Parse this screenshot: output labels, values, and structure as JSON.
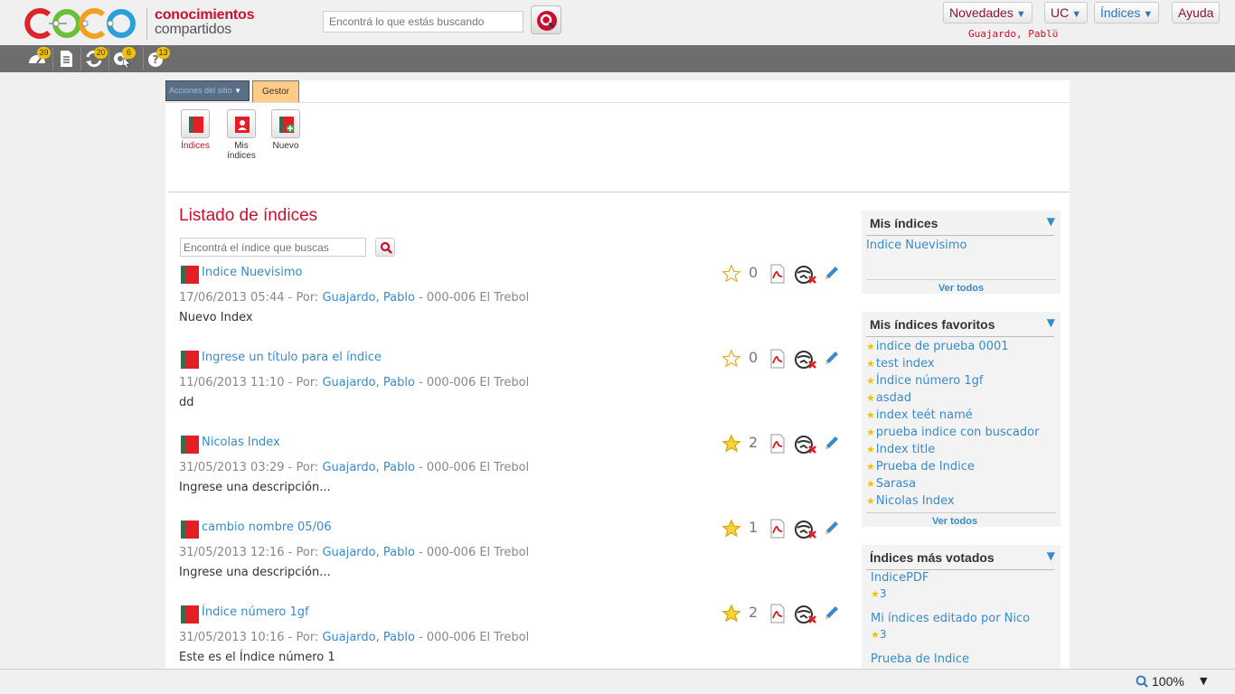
{
  "header": {
    "logo_text_1": "conocimientos",
    "logo_text_2": "compartidos",
    "search_placeholder": "Encontrá lo que estás buscando",
    "nav": [
      {
        "label": "Novedades"
      },
      {
        "label": "UC"
      },
      {
        "label": "Índices"
      },
      {
        "label": "Ayuda"
      }
    ],
    "user_name": "Guajardo, Pablo"
  },
  "toolbar": {
    "badges": [
      "39",
      "",
      "20",
      "6",
      "13"
    ]
  },
  "ribbon": {
    "site_actions": "Acciones del sitio",
    "tab": "Gestor",
    "buttons": [
      {
        "label": "Índices"
      },
      {
        "label": "Mis índices"
      },
      {
        "label": "Nuevo"
      }
    ]
  },
  "main": {
    "title": "Listado de índices",
    "search_placeholder": "Encontrá el índice que buscas",
    "entries": [
      {
        "title": "Indice Nuevisimo",
        "date": "17/06/2013 05:44",
        "por": " - Por: ",
        "author": "Guajardo, Pablo",
        "group": " - 000-006 El Trebol",
        "desc": "Nuevo Index",
        "votes": "0",
        "starred": false
      },
      {
        "title": "Ingrese un título para el índice",
        "date": "11/06/2013 11:10",
        "por": " - Por: ",
        "author": "Guajardo, Pablo",
        "group": " - 000-006 El Trebol",
        "desc": "dd",
        "votes": "0",
        "starred": false
      },
      {
        "title": "Nicolas Index",
        "date": "31/05/2013 03:29",
        "por": " - Por: ",
        "author": "Guajardo, Pablo",
        "group": " - 000-006 El Trebol",
        "desc": "Ingrese una descripción...",
        "votes": "2",
        "starred": true
      },
      {
        "title": "cambio nombre 05/06",
        "date": "31/05/2013 12:16",
        "por": " - Por: ",
        "author": "Guajardo, Pablo",
        "group": " - 000-006 El Trebol",
        "desc": "Ingrese una descripción...",
        "votes": "1",
        "starred": true
      },
      {
        "title": "Índice número 1gf",
        "date": "31/05/2013 10:16",
        "por": " - Por: ",
        "author": "Guajardo, Pablo",
        "group": " - 000-006 El Trebol",
        "desc": "Este es el Índice número 1",
        "votes": "2",
        "starred": true
      }
    ]
  },
  "sidebar": {
    "mis_indices": {
      "title": "Mis índices",
      "items": [
        "Indice Nuevisimo"
      ],
      "footer": "Ver todos"
    },
    "favoritos": {
      "title": "Mis índices favoritos",
      "items": [
        "indice de prueba 0001",
        "test index",
        "Índice número 1gf",
        "asdad",
        "index teét namé",
        "prueba indice con buscador",
        "Index title",
        "Prueba de Indice",
        "Sarasa",
        "Nicolas Index"
      ],
      "footer": "Ver todos"
    },
    "mas_votados": {
      "title": "Índices más votados",
      "items": [
        {
          "name": "IndicePDF",
          "votes": "3"
        },
        {
          "name": "Mi índices editado por Nico",
          "votes": "3"
        },
        {
          "name": "Prueba de Indice",
          "votes": ""
        }
      ]
    }
  },
  "status": {
    "zoom": "100%"
  },
  "colors": {
    "brand_red": "#c8102e",
    "link_blue": "#3a8ac6",
    "star_yellow": "#f2c200"
  }
}
